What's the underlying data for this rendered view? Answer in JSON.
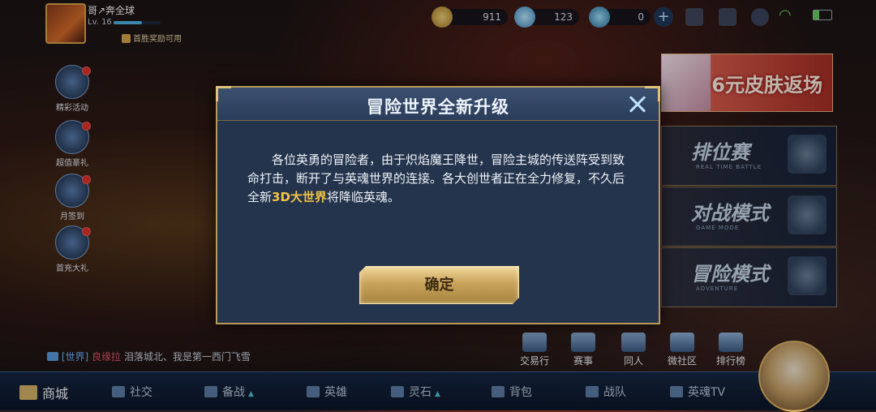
{
  "player": {
    "name": "哥↗奔全球",
    "level": "Lv. 16",
    "level_progress": 0.6,
    "first_win": "首胜奖励可用"
  },
  "currency": {
    "gold": "911",
    "diamond": "123",
    "coupon": "0"
  },
  "side_menu": [
    {
      "label": "精彩活动",
      "icon": "gift-box-icon"
    },
    {
      "label": "超值豪礼",
      "icon": "gem-bag-icon"
    },
    {
      "label": "月签到",
      "icon": "calendar-check-icon"
    },
    {
      "label": "首充大礼",
      "icon": "money-bag-icon"
    }
  ],
  "right_panel": {
    "ad_text": "6元皮肤返场",
    "modes": [
      {
        "title": "排位赛",
        "subtitle": "REAL TIME BATTLE",
        "icon": "trophy-icon"
      },
      {
        "title": "对战模式",
        "subtitle": "GAME MODE",
        "icon": "chess-knight-icon"
      },
      {
        "title": "冒险模式",
        "subtitle": "ADVENTURE",
        "icon": "gate-icon"
      }
    ]
  },
  "shortcuts": [
    {
      "label": "交易行",
      "icon": "trade-icon"
    },
    {
      "label": "赛事",
      "icon": "cup-icon"
    },
    {
      "label": "同人",
      "icon": "fan-art-icon"
    },
    {
      "label": "微社区",
      "icon": "community-icon"
    },
    {
      "label": "排行榜",
      "icon": "ranking-icon"
    }
  ],
  "chat": {
    "channel": "[世界]",
    "user": "良缘拉",
    "message": "泪落城北、我是第一西门飞雪"
  },
  "bottom_nav": [
    {
      "label": "商城",
      "icon": "shop-cart-icon"
    },
    {
      "label": "社交",
      "icon": "friends-icon"
    },
    {
      "label": "备战",
      "icon": "swords-icon"
    },
    {
      "label": "英雄",
      "icon": "helmet-icon"
    },
    {
      "label": "灵石",
      "icon": "stone-icon"
    },
    {
      "label": "背包",
      "icon": "backpack-icon"
    },
    {
      "label": "战队",
      "icon": "team-icon"
    },
    {
      "label": "英魂TV",
      "icon": "tv-icon"
    }
  ],
  "modal": {
    "title": "冒险世界全新升级",
    "body_part1": "各位英勇的冒险者，由于炽焰魔王降世，冒险主城的传送阵受到致命打击，断开了与英魂世界的连接。各大创世者正在全力修复，不久后全新",
    "body_highlight": "3D大世界",
    "body_part2": "将降临英魂。",
    "confirm_label": "确定"
  },
  "colors": {
    "accent_gold": "#f2c24a",
    "modal_bg": "#24344c",
    "frame_gold": "#b79a5c",
    "notify_red": "#e0322b"
  }
}
